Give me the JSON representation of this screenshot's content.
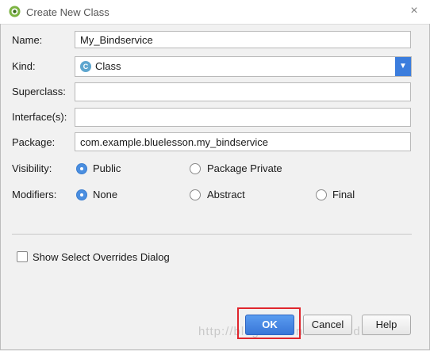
{
  "dialog": {
    "title": "Create New Class",
    "close_glyph": "×",
    "icon": "android-studio-icon"
  },
  "form": {
    "name": {
      "label": "Name:",
      "value": "My_Bindservice"
    },
    "kind": {
      "label": "Kind:",
      "value": "Class",
      "icon_letter": "C",
      "arrow": "▼"
    },
    "superclass": {
      "label": "Superclass:",
      "value": ""
    },
    "interfaces": {
      "label": "Interface(s):",
      "value": ""
    },
    "package": {
      "label": "Package:",
      "value": "com.example.bluelesson.my_bindservice"
    },
    "visibility": {
      "label": "Visibility:",
      "options": [
        {
          "label": "Public",
          "checked": true
        },
        {
          "label": "Package Private",
          "checked": false
        }
      ]
    },
    "modifiers": {
      "label": "Modifiers:",
      "options": [
        {
          "label": "None",
          "checked": true
        },
        {
          "label": "Abstract",
          "checked": false
        },
        {
          "label": "Final",
          "checked": false
        }
      ]
    },
    "show_overrides": {
      "label": "Show Select Overrides Dialog",
      "checked": false
    }
  },
  "buttons": {
    "ok": "OK",
    "cancel": "Cancel",
    "help": "Help"
  },
  "watermark": "http://blog.csdn.net/richard1230",
  "colors": {
    "accent": "#3b7ddd",
    "highlight_box": "#e0262d"
  }
}
